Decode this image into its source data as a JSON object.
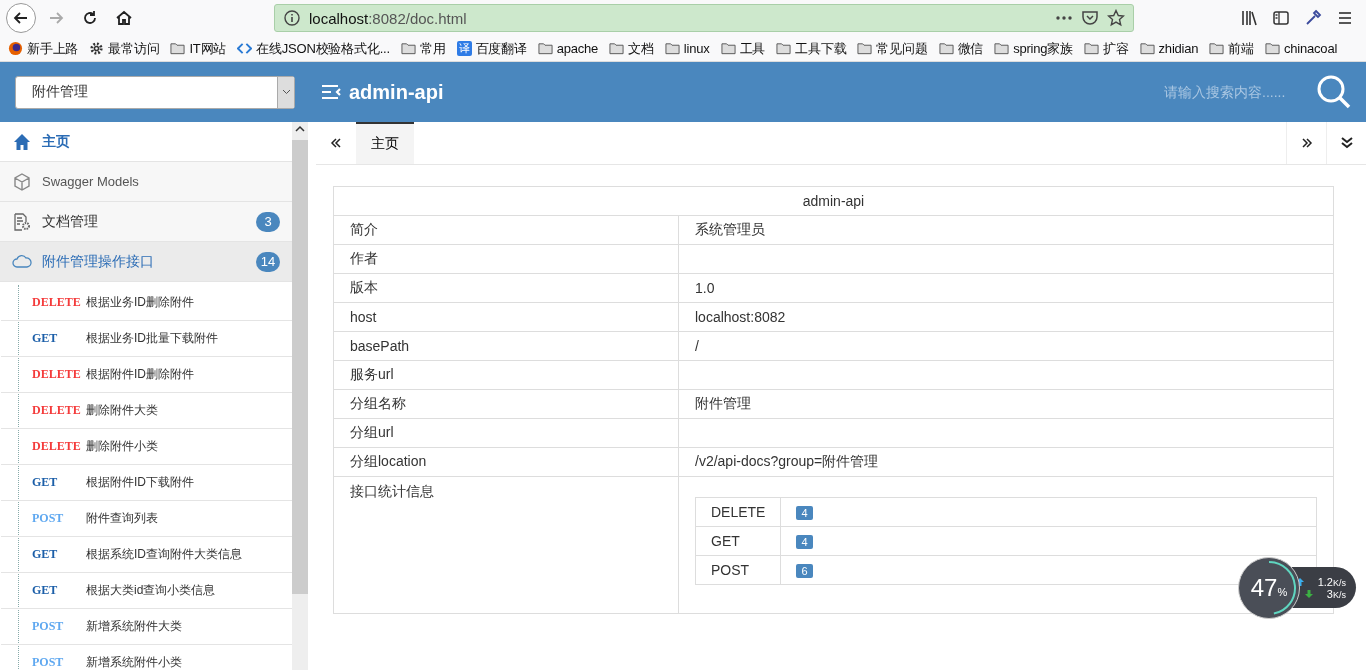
{
  "browser": {
    "url_host": "localhost",
    "url_path": ":8082/doc.html",
    "bookmarks": [
      {
        "kind": "firefox",
        "label": "新手上路"
      },
      {
        "kind": "gear",
        "label": "最常访问"
      },
      {
        "kind": "folder",
        "label": "IT网站"
      },
      {
        "kind": "code",
        "label": "在线JSON校验格式化..."
      },
      {
        "kind": "folder",
        "label": "常用"
      },
      {
        "kind": "translate",
        "label": "百度翻译",
        "glyph": "译"
      },
      {
        "kind": "folder",
        "label": "apache"
      },
      {
        "kind": "folder",
        "label": "文档"
      },
      {
        "kind": "folder",
        "label": "linux"
      },
      {
        "kind": "folder",
        "label": "工具"
      },
      {
        "kind": "folder",
        "label": "工具下载"
      },
      {
        "kind": "folder",
        "label": "常见问题"
      },
      {
        "kind": "folder",
        "label": "微信"
      },
      {
        "kind": "folder",
        "label": "spring家族"
      },
      {
        "kind": "folder",
        "label": "扩容"
      },
      {
        "kind": "folder",
        "label": "zhidian"
      },
      {
        "kind": "folder",
        "label": "前端"
      },
      {
        "kind": "folder",
        "label": "chinacoal"
      }
    ]
  },
  "header": {
    "group_select": "附件管理",
    "title": "admin-api",
    "search": {
      "placeholder": "请输入搜索内容......"
    }
  },
  "sidebar": {
    "items": [
      {
        "kind": "home",
        "label": "主页",
        "selected": true
      },
      {
        "kind": "models",
        "label": "Swagger Models",
        "selected": false
      },
      {
        "kind": "docs",
        "label": "文档管理",
        "badge": "3",
        "selected": false,
        "expanded": false
      },
      {
        "kind": "api",
        "label": "附件管理操作接口",
        "badge": "14",
        "selected": false,
        "expanded": true,
        "children": [
          {
            "method": "DELETE",
            "color": "#f43b3b",
            "label": "根据业务ID删除附件"
          },
          {
            "method": "GET",
            "color": "#1b5ea8",
            "label": "根据业务ID批量下载附件"
          },
          {
            "method": "DELETE",
            "color": "#f43b3b",
            "label": "根据附件ID删除附件"
          },
          {
            "method": "DELETE",
            "color": "#f43b3b",
            "label": "删除附件大类"
          },
          {
            "method": "DELETE",
            "color": "#f43b3b",
            "label": "删除附件小类"
          },
          {
            "method": "GET",
            "color": "#1b5ea8",
            "label": "根据附件ID下载附件"
          },
          {
            "method": "POST",
            "color": "#5fa8f0",
            "label": "附件查询列表"
          },
          {
            "method": "GET",
            "color": "#1b5ea8",
            "label": "根据系统ID查询附件大类信息"
          },
          {
            "method": "GET",
            "color": "#1b5ea8",
            "label": "根据大类id查询小类信息"
          },
          {
            "method": "POST",
            "color": "#5fa8f0",
            "label": "新增系统附件大类"
          },
          {
            "method": "POST",
            "color": "#5fa8f0",
            "label": "新增系统附件小类"
          }
        ]
      }
    ]
  },
  "tabs": [
    {
      "label": "主页",
      "selected": true
    }
  ],
  "info_table": {
    "title": "admin-api",
    "rows": [
      {
        "label": "简介",
        "value": "系统管理员"
      },
      {
        "label": "作者"
      },
      {
        "label": "版本",
        "value": "1.0"
      },
      {
        "label": "host",
        "value": "localhost:8082"
      },
      {
        "label": "basePath",
        "value": "/"
      },
      {
        "label": "服务url"
      },
      {
        "label": "分组名称",
        "value": "附件管理"
      },
      {
        "label": "分组url"
      },
      {
        "label": "分组location",
        "value": "/v2/api-docs?group=附件管理"
      },
      {
        "label": "接口统计信息",
        "stats": [
          {
            "method": "DELETE",
            "count": "4"
          },
          {
            "method": "GET",
            "count": "4"
          },
          {
            "method": "POST",
            "count": "6"
          }
        ]
      }
    ]
  },
  "net_widget": {
    "percent": "47",
    "unit": "%",
    "level": 0.47,
    "up": "1.2",
    "up_unit": "K/s",
    "down": "3",
    "down_unit": "K/s"
  }
}
